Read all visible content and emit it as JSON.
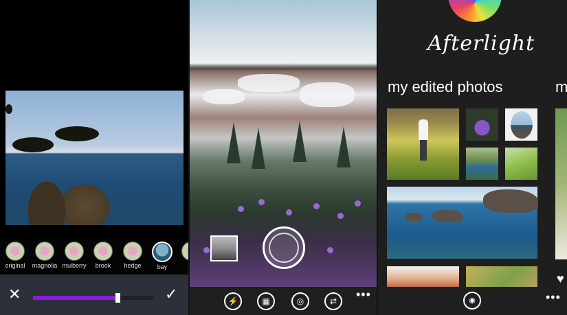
{
  "filters": {
    "items": [
      {
        "label": "original"
      },
      {
        "label": "magnolia"
      },
      {
        "label": "mulberry"
      },
      {
        "label": "brook"
      },
      {
        "label": "hedge"
      },
      {
        "label": "bay"
      }
    ],
    "selected": "bay"
  },
  "editor": {
    "cancel_glyph": "✕",
    "confirm_glyph": "✓",
    "strength_fraction": 0.68
  },
  "camera": {
    "icons": [
      "flash-off-icon",
      "grid-icon",
      "aperture-icon",
      "switch-camera-icon"
    ],
    "flash_glyph": "⚡",
    "grid_glyph": "▦",
    "aperture_glyph": "◎",
    "switch_glyph": "⇄",
    "more_glyph": "•••"
  },
  "gallery": {
    "logo_text": "Afterlight",
    "title": "my edited photos",
    "next_title_peek": "m",
    "camera_glyph": "◉",
    "heart_glyph": "♥",
    "more_glyph": "•••"
  },
  "colors": {
    "accent_purple": "#8e1be0",
    "editbar_bg": "#2c3139",
    "appbar_bg": "#1f1f1f"
  }
}
